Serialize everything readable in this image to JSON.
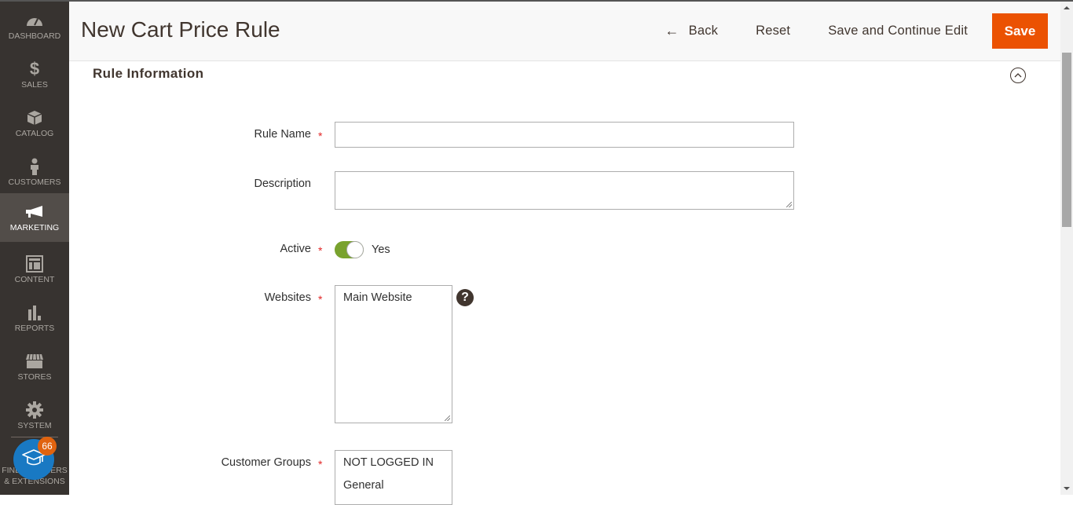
{
  "sidebar": {
    "items": [
      {
        "label": "Dashboard",
        "icon": "dashboard-icon"
      },
      {
        "label": "Sales",
        "icon": "dollar-icon"
      },
      {
        "label": "Catalog",
        "icon": "box-icon"
      },
      {
        "label": "Customers",
        "icon": "person-icon"
      },
      {
        "label": "Marketing",
        "icon": "megaphone-icon",
        "active": true
      },
      {
        "label": "Content",
        "icon": "layout-icon"
      },
      {
        "label": "Reports",
        "icon": "bar-chart-icon"
      },
      {
        "label": "Stores",
        "icon": "storefront-icon"
      },
      {
        "label": "System",
        "icon": "gear-icon"
      }
    ],
    "partners_line1": "FIND PARTNERS",
    "partners_line2": "& EXTENSIONS",
    "learn_badge_count": "66"
  },
  "header": {
    "title": "New Cart Price Rule",
    "back_label": "Back",
    "reset_label": "Reset",
    "save_continue_label": "Save and Continue Edit",
    "save_label": "Save"
  },
  "section": {
    "title": "Rule Information"
  },
  "form": {
    "rule_name": {
      "label": "Rule Name",
      "value": "",
      "required": true
    },
    "description": {
      "label": "Description",
      "value": ""
    },
    "active": {
      "label": "Active",
      "value": "Yes",
      "checked": true,
      "required": true
    },
    "websites": {
      "label": "Websites",
      "options": [
        "Main Website"
      ],
      "required": true
    },
    "customer_groups": {
      "label": "Customer Groups",
      "options": [
        "NOT LOGGED IN",
        "General"
      ],
      "required": true
    }
  },
  "colors": {
    "accent": "#eb5202",
    "sidebar_bg": "#373330",
    "toggle_on": "#79a22e",
    "required": "#e22626"
  }
}
